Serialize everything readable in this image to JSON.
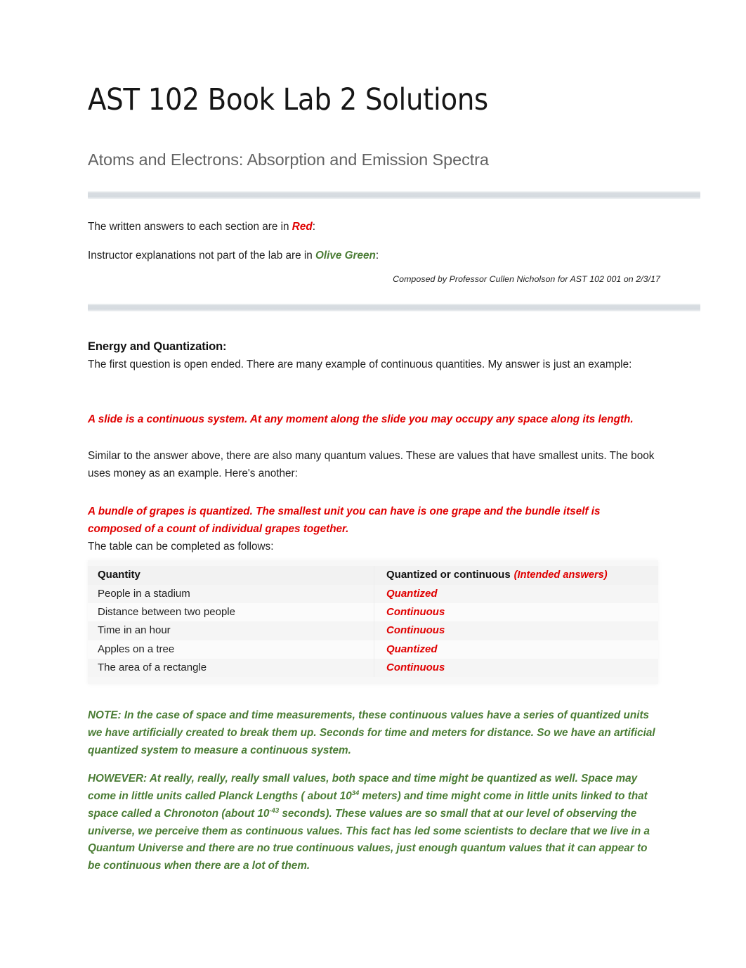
{
  "document": {
    "title": "AST 102 Book Lab 2 Solutions",
    "subtitle": "Atoms and Electrons: Absorption and Emission Spectra",
    "credit": "Composed by Professor Cullen Nicholson for AST 102 001 on 2/3/17"
  },
  "legend": {
    "red_line_prefix": "The written answers to each section are in ",
    "red_word": "Red",
    "red_line_suffix": ":",
    "green_line_prefix": "Instructor explanations not part of the lab are in ",
    "green_word": "Olive Green",
    "green_line_suffix": ":"
  },
  "colors": {
    "answer_red": "#e00000",
    "note_green": "#4a7c34",
    "divider_gray": "#d6dbe0",
    "subtitle_gray": "#636363"
  },
  "section": {
    "heading": "Energy and Quantization:",
    "paragraph_1": "The first question is open ended. There are many example of continuous quantities. My answer is just an example:",
    "answer_1": "A slide is a continuous system. At any moment along the slide you may occupy any space along its length.",
    "paragraph_2": "Similar to the answer above, there are also many quantum values. These are values that have smallest units. The book uses money as an example. Here's another:",
    "answer_2": "A bundle of grapes is quantized. The smallest unit you can have is one grape and the bundle itself is composed of a count of individual grapes together.",
    "table_lead": "The table can be completed as follows:"
  },
  "table": {
    "header_left": "Quantity",
    "header_right": "Quantized or continuous",
    "header_right_note": "(Intended answers)",
    "rows": [
      {
        "quantity": "People in a stadium",
        "answer": "Quantized"
      },
      {
        "quantity": "Distance between two people",
        "answer": "Continuous"
      },
      {
        "quantity": "Time in an hour",
        "answer": "Continuous"
      },
      {
        "quantity": "Apples on a tree",
        "answer": "Quantized"
      },
      {
        "quantity": "The area of a rectangle",
        "answer": "Continuous"
      }
    ]
  },
  "notes": {
    "note_1": "NOTE: In the case of space and time measurements, these continuous values have a series of quantized units we have artificially created to break them up. Seconds for time and meters for distance. So we have an artificial quantized system to measure a continuous system.",
    "note_2_part_1": "HOWEVER: At really, really, really small values, both space and time might be quantized as well. Space may come in little units called Planck Lengths ( about 10",
    "note_2_sup_1": "34",
    "note_2_part_2": " meters) and time might come in little units linked to that space called a Chronoton (about 10",
    "note_2_sup_2": "-43",
    "note_2_part_3": " seconds). These values are so small that at our level of observing the universe, we perceive them as continuous values. This fact has led some scientists to declare that we live in a Quantum Universe and there are no true continuous values, just enough quantum values that it can appear to be continuous when there are a lot of them."
  }
}
